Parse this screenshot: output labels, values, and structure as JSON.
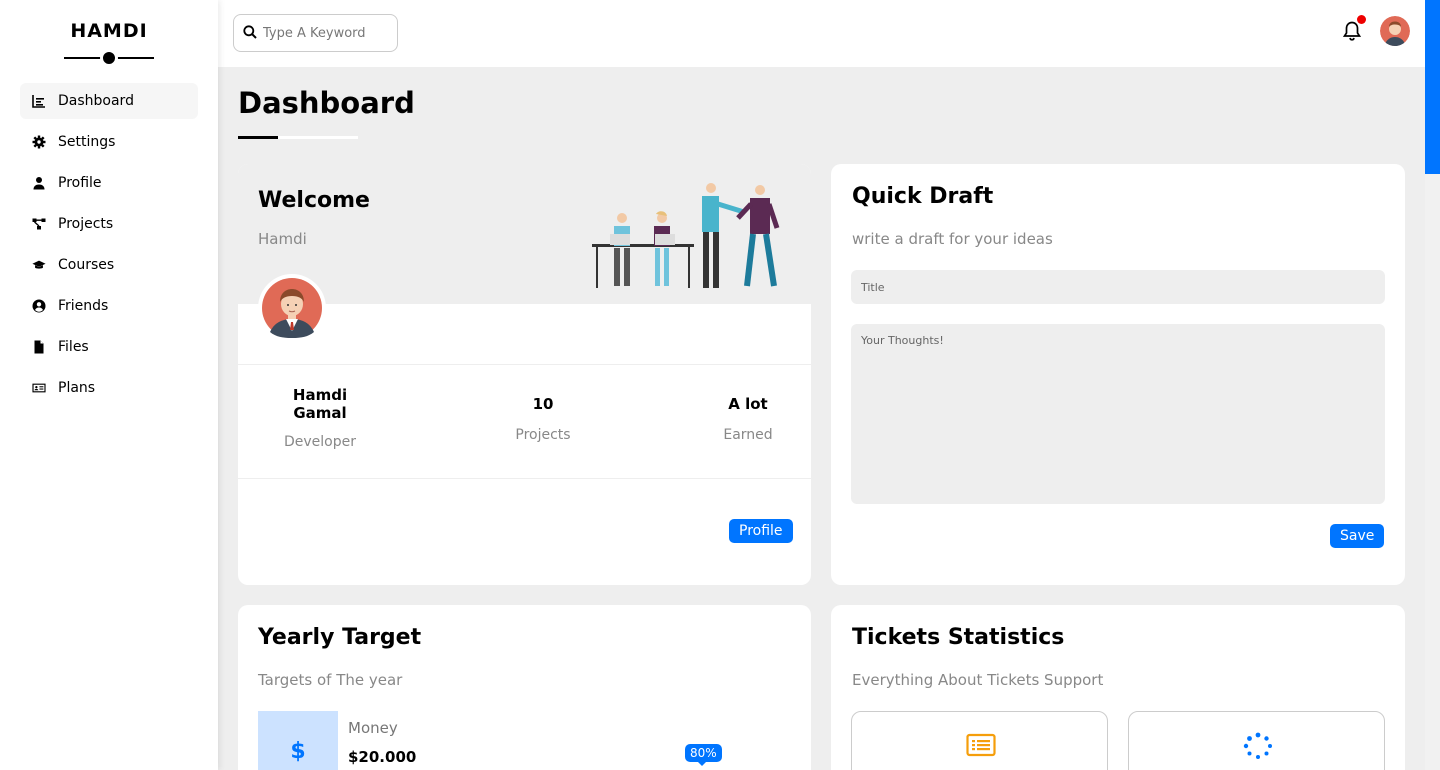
{
  "brand": {
    "name": "HAMDI"
  },
  "sidebar": {
    "items": [
      {
        "label": "Dashboard",
        "icon": "chart-icon",
        "active": true
      },
      {
        "label": "Settings",
        "icon": "gear-icon"
      },
      {
        "label": "Profile",
        "icon": "user-icon"
      },
      {
        "label": "Projects",
        "icon": "diagram-icon"
      },
      {
        "label": "Courses",
        "icon": "graduation-cap-icon"
      },
      {
        "label": "Friends",
        "icon": "user-circle-icon"
      },
      {
        "label": "Files",
        "icon": "file-icon"
      },
      {
        "label": "Plans",
        "icon": "id-card-icon"
      }
    ]
  },
  "header": {
    "search_placeholder": "Type A Keyword",
    "notification_dot": true
  },
  "page": {
    "title": "Dashboard"
  },
  "welcome": {
    "title": "Welcome",
    "username": "Hamdi",
    "stats": [
      {
        "value_line1": "Hamdi",
        "value_line2": "Gamal",
        "label": "Developer"
      },
      {
        "value": "10",
        "label": "Projects"
      },
      {
        "value": "A lot",
        "label": "Earned"
      }
    ],
    "profile_button": "Profile"
  },
  "draft": {
    "title": "Quick Draft",
    "subtitle": "write a draft for your ideas",
    "title_placeholder": "Title",
    "body_placeholder": "Your Thoughts!",
    "save_button": "Save"
  },
  "yearly": {
    "title": "Yearly Target",
    "subtitle": "Targets of The year",
    "money_icon": "$",
    "money_label": "Money",
    "money_value": "$20.000",
    "progress_label": "80%",
    "progress": 0.8
  },
  "tickets": {
    "title": "Tickets Statistics",
    "subtitle": "Everything About Tickets Support",
    "boxes": [
      {
        "icon": "list-icon",
        "color": "#f59e0b"
      },
      {
        "icon": "spinner-icon",
        "color": "#0075ff"
      }
    ]
  },
  "colors": {
    "accent": "#0075ff",
    "background": "#eeeeee",
    "notification": "#ee0000"
  }
}
